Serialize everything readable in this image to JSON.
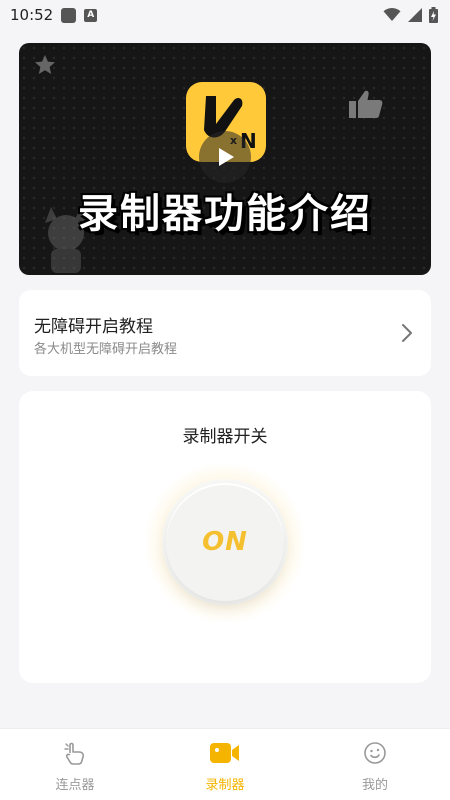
{
  "status_bar": {
    "time": "10:52",
    "icons": [
      "square-notification-icon",
      "a-notification-icon",
      "wifi-icon",
      "signal-icon",
      "battery-charging-icon"
    ]
  },
  "banner": {
    "title": "录制器功能介绍",
    "icons": [
      "app-logo",
      "play-icon",
      "star-icon",
      "thumbs-up-icon"
    ]
  },
  "tutorial": {
    "title": "无障碍开启教程",
    "subtitle": "各大机型无障碍开启教程"
  },
  "recorder_switch": {
    "title": "录制器开关",
    "state": "ON"
  },
  "bottom_nav": {
    "items": [
      {
        "label": "连点器",
        "icon": "tap-hand-icon",
        "active": false
      },
      {
        "label": "录制器",
        "icon": "video-camera-icon",
        "active": true
      },
      {
        "label": "我的",
        "icon": "smiley-face-icon",
        "active": false
      }
    ]
  },
  "colors": {
    "accent": "#f5b400",
    "background": "#f5f5f7",
    "card": "#ffffff",
    "on_text": "#f5c030"
  }
}
